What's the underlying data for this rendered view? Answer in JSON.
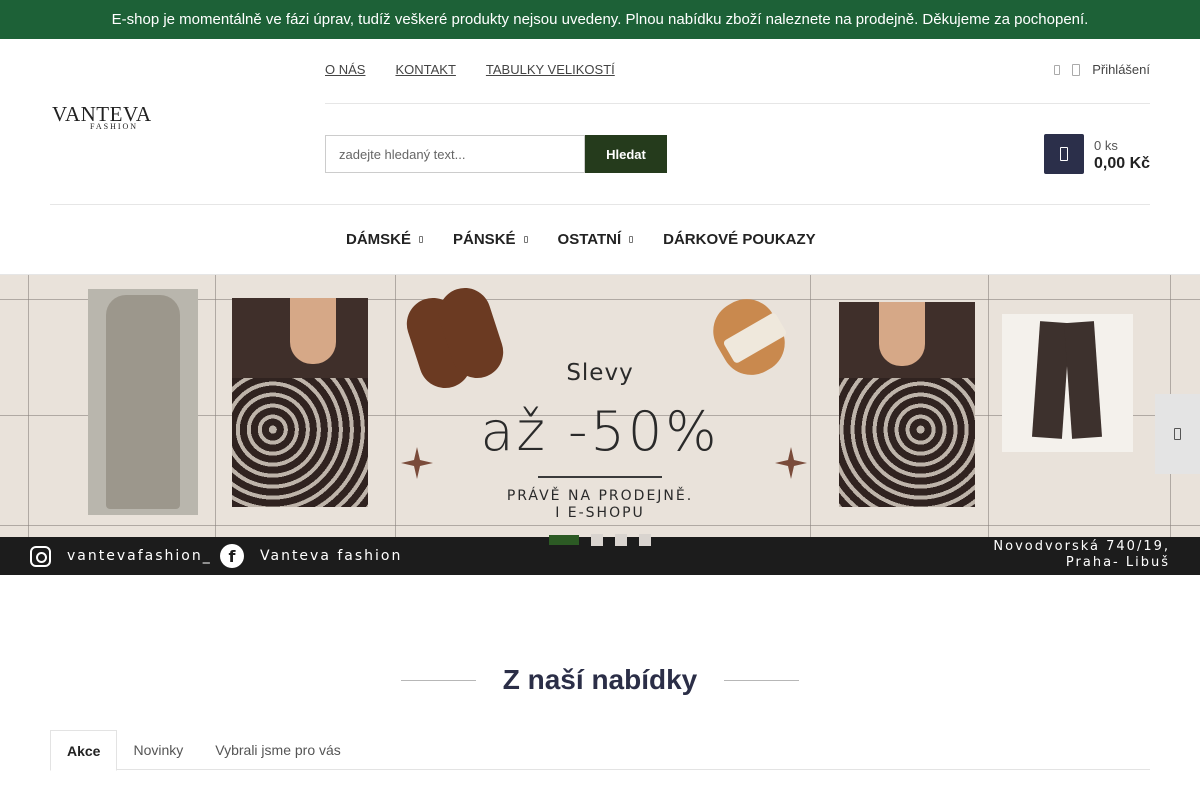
{
  "notice": {
    "text": "E-shop je momentálně ve fázi úprav, tudíž veškeré produkty nejsou uvedeny. Plnou nabídku zboží naleznete na prodejně. Děkujeme za pochopení."
  },
  "logo": {
    "text": "VANTEVA",
    "sub": "FASHION"
  },
  "top_links": [
    {
      "label": "O NÁS"
    },
    {
      "label": "KONTAKT"
    },
    {
      "label": "TABULKY VELIKOSTÍ"
    }
  ],
  "login": {
    "label": "Přihlášení"
  },
  "search": {
    "placeholder": "zadejte hledaný text...",
    "button_label": "Hledat"
  },
  "cart": {
    "qty": "0 ks",
    "total": "0,00 Kč"
  },
  "main_nav": [
    {
      "label": "DÁMSKÉ",
      "has_caret": true
    },
    {
      "label": "PÁNSKÉ",
      "has_caret": true
    },
    {
      "label": "OSTATNÍ",
      "has_caret": true
    },
    {
      "label": "DÁRKOVÉ POUKAZY",
      "has_caret": false
    }
  ],
  "banner": {
    "headline": "Slevy",
    "discount": "až -50%",
    "subline1": "PRÁVĚ NA PRODEJNĚ.",
    "subline2": "I E-SHOPU",
    "instagram": "vantevafashion_",
    "facebook": "Vanteva fashion",
    "address_line1": "Novodvorská 740/19,",
    "address_line2": "Praha- Libuš",
    "slides": 4,
    "active_slide": 1
  },
  "offer": {
    "title": "Z naší nabídky",
    "tabs": [
      {
        "label": "Akce",
        "active": true
      },
      {
        "label": "Novinky",
        "active": false
      },
      {
        "label": "Vybrali jsme pro vás",
        "active": false
      }
    ]
  },
  "colors": {
    "notice_bg": "#1d6137",
    "search_button": "#253b1c",
    "cart_button": "#2b2f4a",
    "active_dot": "#2c5a24",
    "title": "#2b2e47"
  }
}
